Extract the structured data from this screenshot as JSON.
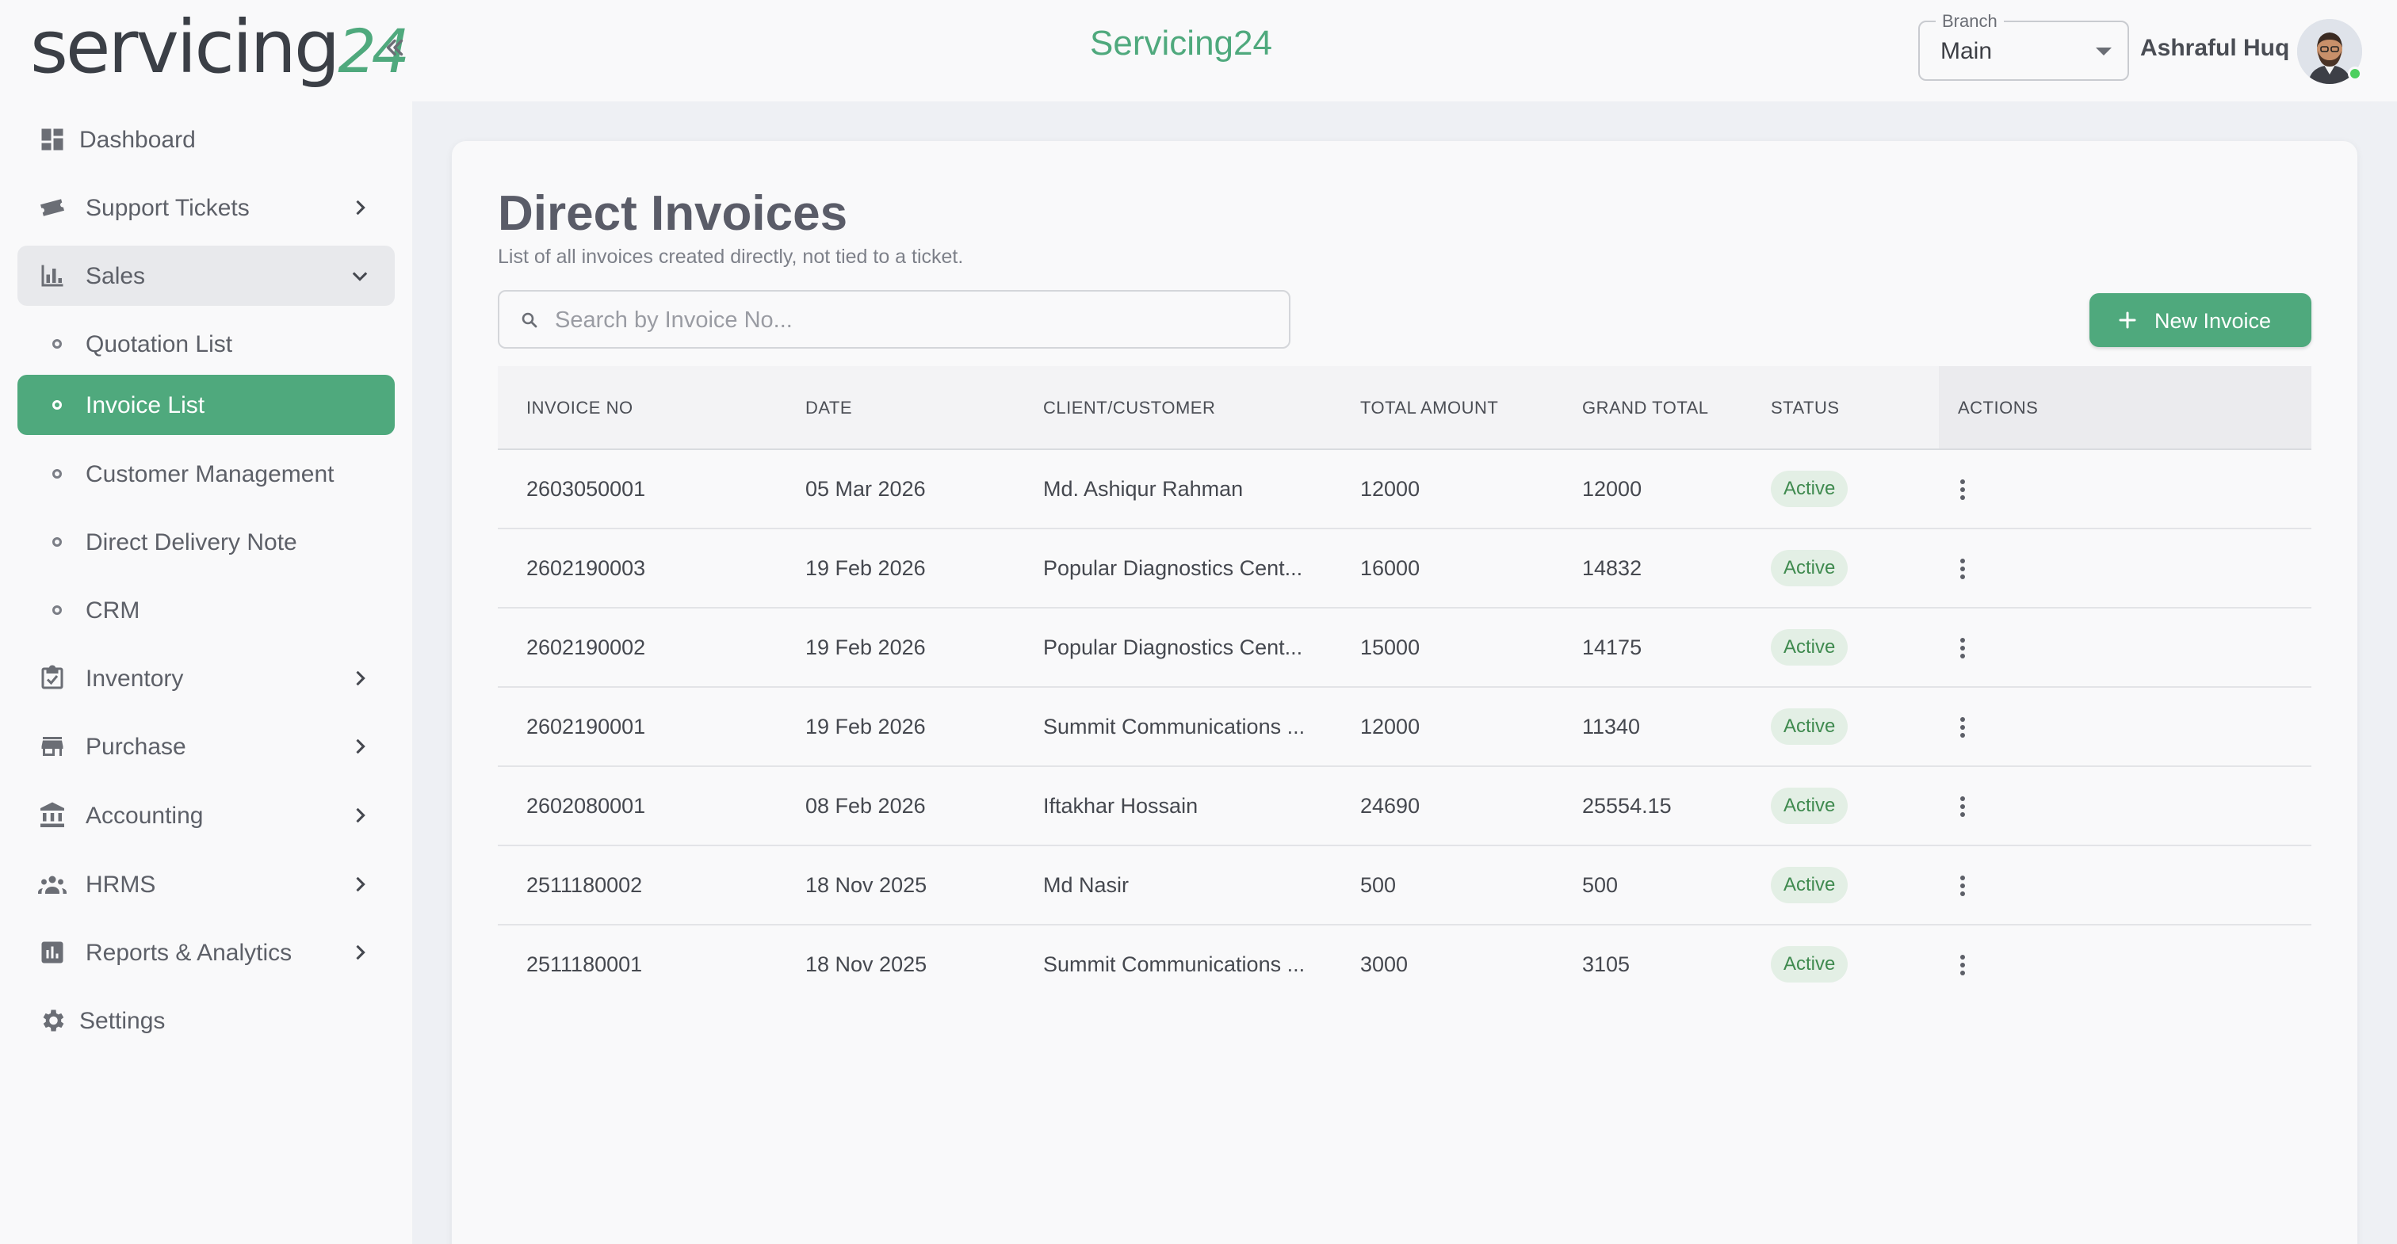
{
  "header": {
    "logo_text": "servicing",
    "logo_number": "24",
    "app_title": "Servicing24",
    "branch": {
      "label": "Branch",
      "value": "Main"
    },
    "user_name": "Ashraful Huq"
  },
  "sidebar": {
    "items": [
      {
        "label": "Dashboard",
        "icon": "dashboard-icon"
      },
      {
        "label": "Support Tickets",
        "icon": "ticket-icon"
      },
      {
        "label": "Sales",
        "icon": "bar-chart-icon"
      },
      {
        "label": "Quotation List"
      },
      {
        "label": "Invoice List"
      },
      {
        "label": "Customer Management"
      },
      {
        "label": "Direct Delivery Note"
      },
      {
        "label": "CRM"
      },
      {
        "label": "Inventory",
        "icon": "inventory-icon"
      },
      {
        "label": "Purchase",
        "icon": "store-icon"
      },
      {
        "label": "Accounting",
        "icon": "bank-icon"
      },
      {
        "label": "HRMS",
        "icon": "people-icon"
      },
      {
        "label": "Reports & Analytics",
        "icon": "report-icon"
      },
      {
        "label": "Settings",
        "icon": "gear-icon"
      }
    ]
  },
  "main": {
    "title": "Direct Invoices",
    "subtitle": "List of all invoices created directly, not tied to a ticket.",
    "search_placeholder": "Search by Invoice No...",
    "new_button_label": "New Invoice",
    "columns": [
      "INVOICE NO",
      "DATE",
      "CLIENT/CUSTOMER",
      "TOTAL AMOUNT",
      "GRAND TOTAL",
      "STATUS",
      "ACTIONS"
    ],
    "rows": [
      {
        "invoice_no": "2603050001",
        "date": "05 Mar 2026",
        "client": "Md. Ashiqur Rahman",
        "total": "12000",
        "grand_total": "12000",
        "status": "Active"
      },
      {
        "invoice_no": "2602190003",
        "date": "19 Feb 2026",
        "client": "Popular Diagnostics Cent...",
        "total": "16000",
        "grand_total": "14832",
        "status": "Active"
      },
      {
        "invoice_no": "2602190002",
        "date": "19 Feb 2026",
        "client": "Popular Diagnostics Cent...",
        "total": "15000",
        "grand_total": "14175",
        "status": "Active"
      },
      {
        "invoice_no": "2602190001",
        "date": "19 Feb 2026",
        "client": "Summit Communications ...",
        "total": "12000",
        "grand_total": "11340",
        "status": "Active"
      },
      {
        "invoice_no": "2602080001",
        "date": "08 Feb 2026",
        "client": "Iftakhar Hossain",
        "total": "24690",
        "grand_total": "25554.15",
        "status": "Active"
      },
      {
        "invoice_no": "2511180002",
        "date": "18 Nov 2025",
        "client": "Md Nasir",
        "total": "500",
        "grand_total": "500",
        "status": "Active"
      },
      {
        "invoice_no": "2511180001",
        "date": "18 Nov 2025",
        "client": "Summit Communications ...",
        "total": "3000",
        "grand_total": "3105",
        "status": "Active"
      }
    ]
  },
  "colors": {
    "accent": "#4fa97d",
    "status_bg": "#e3efe5",
    "status_text": "#3f8a4f"
  }
}
